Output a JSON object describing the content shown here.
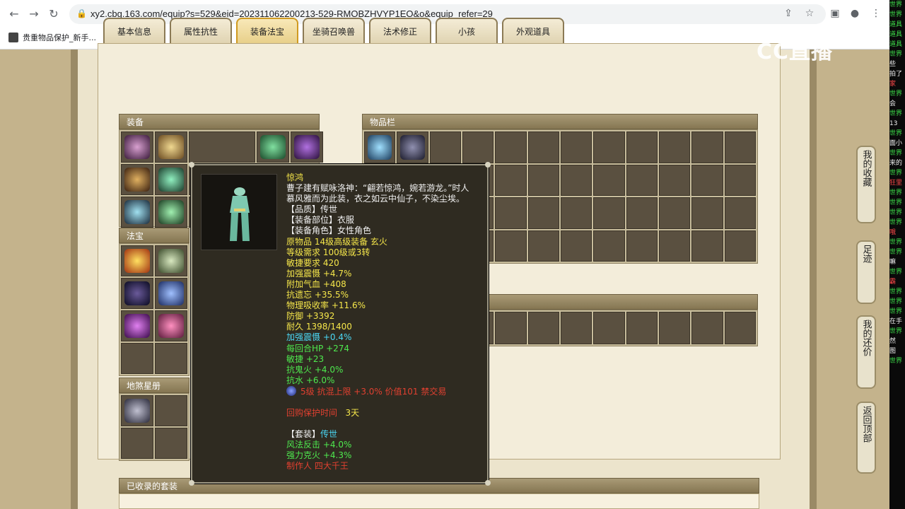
{
  "browser": {
    "url": "xy2.cbg.163.com/equip?s=529&eid=202311062200213-529-RMOBZHVYP1EO&o&equip_refer=29",
    "bookmark": "贵重物品保护_新手..."
  },
  "overlay": {
    "logo": "CC直播"
  },
  "tabs": [
    {
      "label": "基本信息"
    },
    {
      "label": "属性抗性"
    },
    {
      "label": "装备法宝"
    },
    {
      "label": "坐骑召唤兽"
    },
    {
      "label": "法术修正"
    },
    {
      "label": "小孩"
    },
    {
      "label": "外观道具"
    }
  ],
  "panels": {
    "equipment": "装备",
    "fabao": "法宝",
    "disha": "地煞星册",
    "inventory": "物品栏",
    "sets": "已收录的套装"
  },
  "tooltip": {
    "name": "惊鸿",
    "desc1": "曹子建有赋咏洛神：“翩若惊鸿，婉若游龙。”时人",
    "desc2": "慕风雅而为此装，衣之如云中仙子，不染尘埃。",
    "quality": "【品质】传世",
    "slot": "【装备部位】衣服",
    "role": "【装备角色】女性角色",
    "origin": "原物品 14级高级装备 玄火",
    "level_req": "等级需求 100级或3转",
    "agi_req": "敏捷要求 420",
    "s1": "加强震慑 +4.7%",
    "s2": "附加气血 +408",
    "s3": "抗遗忘 +35.5%",
    "s4": "物理吸收率 +11.6%",
    "s5": "防御 +3392",
    "durability": "耐久 1398/1400",
    "b1": "加强震慑 +0.4%",
    "b2": "每回合HP +274",
    "b3": "敏捷 +23",
    "b4": "抗鬼火 +4.0%",
    "b5": "抗水 +6.0%",
    "gem_line": "5级 抗混上限 +3.0% 价值101 禁交易",
    "protect_label": "回购保护时间",
    "protect_value": "3天",
    "set_label": "【套装】",
    "set_value": "传世",
    "set1": "风法反击 +4.0%",
    "set2": "强力克火 +4.3%",
    "maker": "制作人 四大千王"
  },
  "side_buttons": [
    {
      "label": "我的收藏"
    },
    {
      "label": "足迹"
    },
    {
      "label": "我的还价"
    },
    {
      "label": "返回顶部"
    }
  ],
  "chat": [
    "世界",
    "世界",
    "道具",
    "道具",
    "道具",
    "世界",
    "些",
    "拍了",
    "家",
    "世界",
    "会",
    "世界",
    "13",
    "世界",
    "面小",
    "世界",
    "来的",
    "世界",
    "狂里",
    "世界",
    "世界",
    "世界",
    "世界",
    "哦",
    "世界",
    "世界",
    "嘛",
    "世界",
    "霸",
    "世界",
    "世界",
    "世界",
    "在手",
    "世界",
    "然",
    "图",
    "世界"
  ]
}
